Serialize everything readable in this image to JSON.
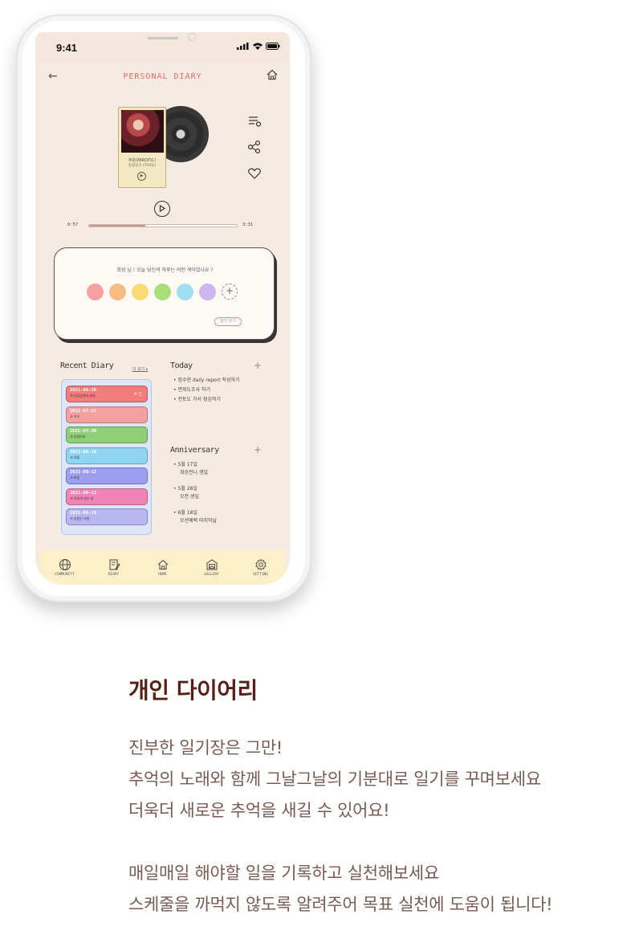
{
  "status_bar": {
    "time": "9:41"
  },
  "app": {
    "title": "PERSONAL DIARY"
  },
  "player": {
    "song_title": "주문(MIROTIC)",
    "song_artist": "동방신기 (TVXQ)",
    "current_time": "0:57",
    "total_time": "3:31",
    "progress": 0.38
  },
  "mood": {
    "question": "희성 님 ! 오늘 당신의 하루는 어떤 색이었나요 ?",
    "colors": [
      "#f8a0a0",
      "#f9bc80",
      "#f9dc75",
      "#a8df7c",
      "#9fdff2",
      "#cfb6f2"
    ],
    "add_symbol": "+",
    "write_label": "일기 쓰기"
  },
  "recent": {
    "title": "Recent Diary",
    "more": "더 보기 ▸",
    "entries": [
      {
        "date": "2021-06-30",
        "text": "♬ 다음꿈에서 봐요",
        "tag": "# 건",
        "color": "#f27b7b"
      },
      {
        "date": "2021-07-21",
        "text": "♬ 약속",
        "tag": "",
        "color": "#f5a0a0"
      },
      {
        "date": "2021-07-30",
        "text": "♬ 비밀번호",
        "tag": "",
        "color": "#8fcf78"
      },
      {
        "date": "2021-08-10",
        "text": "♬ 여름",
        "tag": "",
        "color": "#8fd4f0"
      },
      {
        "date": "2021-08-12",
        "text": "♬ 파랑",
        "tag": "",
        "color": "#9c9ef0"
      },
      {
        "date": "2021-08-13",
        "text": "♬ 작내와 약은 날",
        "tag": "",
        "color": "#f084b5"
      },
      {
        "date": "2021-09-10",
        "text": "♬ 슬픔인 모험",
        "tag": "",
        "color": "#b9b6f2"
      }
    ]
  },
  "today": {
    "title": "Today",
    "plus": "+",
    "items": [
      "• 정수현 daily report 작성하기",
      "• 면죄도조사 하기",
      "• 컨토도 가서 점심먹기"
    ]
  },
  "anniversary": {
    "title": "Anniversary",
    "plus": "+",
    "items": [
      {
        "date": "• 5월 17일",
        "text": "희승언니 생일"
      },
      {
        "date": "• 5월 28일",
        "text": "오전 생일"
      },
      {
        "date": "• 6월 18일",
        "text": "오션예랙 마지막날"
      }
    ]
  },
  "nav": [
    {
      "label": "COMMUNITY",
      "icon": "globe-icon"
    },
    {
      "label": "DIARY",
      "icon": "diary-icon"
    },
    {
      "label": "HOME",
      "icon": "home-icon"
    },
    {
      "label": "GALLERY",
      "icon": "gallery-icon"
    },
    {
      "label": "SETTING",
      "icon": "gear-icon"
    }
  ],
  "feature": {
    "title": "개인 다이어리",
    "para1": [
      "진부한 일기장은 그만!",
      "추억의 노래와 함께 그날그날의 기분대로 일기를 꾸며보세요",
      "더욱더 새로운 추억을 새길 수 있어요!"
    ],
    "para2": [
      "매일매일 해야할 일을 기록하고 실천해보세요",
      "스케줄을 까먹지 않도록 알려주어 목표 실천에 도움이 됩니다!"
    ]
  }
}
